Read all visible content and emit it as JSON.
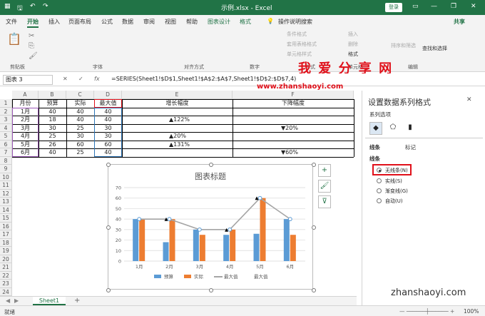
{
  "title_bar": {
    "doc_title": "示例.xlsx - Excel",
    "login": "登录",
    "minimize": "—",
    "restore": "❐",
    "close": "✕",
    "ribbon_display": "▭"
  },
  "menu": {
    "tabs": [
      "文件",
      "开始",
      "插入",
      "页面布局",
      "公式",
      "数据",
      "审阅",
      "视图",
      "帮助",
      "图表设计",
      "格式"
    ],
    "active_tab": "开始",
    "tell_me": "操作说明搜索",
    "share": "共享"
  },
  "ribbon": {
    "groups": [
      "剪贴板",
      "字体",
      "对齐方式",
      "数字",
      "样式",
      "单元格",
      "编辑"
    ],
    "cond_format": "条件格式",
    "table_format": "套用表格格式",
    "cell_styles": "单元格样式",
    "insert": "插入",
    "delete": "删除",
    "format": "格式",
    "sort_filter": "排序和筛选",
    "find_select": "查找和选择"
  },
  "watermark": {
    "cn": "我 爱 分 享 网",
    "url": "www.zhanshaoyi.com",
    "footer": "zhanshaoyi.com"
  },
  "formula_bar": {
    "name_box": "图表 3",
    "cancel": "✕",
    "enter": "✓",
    "fx": "fx",
    "formula": "=SERIES(Sheet1!$D$1,Sheet1!$A$2:$A$7,Sheet1!$D$2:$D$7,4)"
  },
  "columns": [
    "A",
    "B",
    "C",
    "D",
    "E",
    "F"
  ],
  "rows": [
    "1",
    "2",
    "3",
    "4",
    "5",
    "6",
    "7",
    "8",
    "9",
    "10",
    "11",
    "12",
    "13",
    "14",
    "15",
    "16",
    "17",
    "18",
    "19",
    "20",
    "21",
    "22",
    "23",
    "24"
  ],
  "table": {
    "headers": [
      "月份",
      "预算",
      "实际",
      "最大值",
      "增长幅度",
      "下降幅度"
    ],
    "rows": [
      [
        "1月",
        "40",
        "40",
        "40",
        "",
        ""
      ],
      [
        "2月",
        "18",
        "40",
        "40",
        "▲122%",
        ""
      ],
      [
        "3月",
        "30",
        "25",
        "30",
        "",
        "▼20%"
      ],
      [
        "4月",
        "25",
        "30",
        "30",
        "▲20%",
        ""
      ],
      [
        "5月",
        "26",
        "60",
        "60",
        "▲131%",
        ""
      ],
      [
        "6月",
        "40",
        "25",
        "40",
        "",
        "▼60%"
      ]
    ]
  },
  "chart_data": {
    "type": "bar",
    "title": "图表标题",
    "categories": [
      "1月",
      "2月",
      "3月",
      "4月",
      "5月",
      "6月"
    ],
    "ylim": [
      0,
      70
    ],
    "yticks": [
      0,
      10,
      20,
      30,
      40,
      50,
      60,
      70
    ],
    "series": [
      {
        "name": "预算",
        "values": [
          40,
          18,
          30,
          25,
          26,
          40
        ],
        "color": "#5b9bd5"
      },
      {
        "name": "实际",
        "values": [
          40,
          40,
          25,
          30,
          60,
          25
        ],
        "color": "#ed7d31"
      },
      {
        "name": "最大值",
        "values": [
          40,
          40,
          30,
          30,
          60,
          40
        ],
        "color": "#a5a5a5",
        "kind": "line"
      }
    ],
    "extra_legend": "最大值",
    "markers": [
      {
        "category": "2月",
        "symbol": "▲"
      },
      {
        "category": "4月",
        "symbol": "▲"
      },
      {
        "category": "5月",
        "symbol": "▲"
      }
    ],
    "legend_position": "bottom"
  },
  "panel": {
    "title": "设置数据系列格式",
    "series_options": "系列选项",
    "tab_line": "线条",
    "tab_marker": "标记",
    "section": "线条",
    "options": [
      "无线条(N)",
      "实线(S)",
      "渐变线(G)",
      "自动(U)"
    ],
    "selected": 0
  },
  "sheet_tab": "Sheet1",
  "add_sheet": "+",
  "status": {
    "left": "就绪",
    "zoom": "100%"
  }
}
